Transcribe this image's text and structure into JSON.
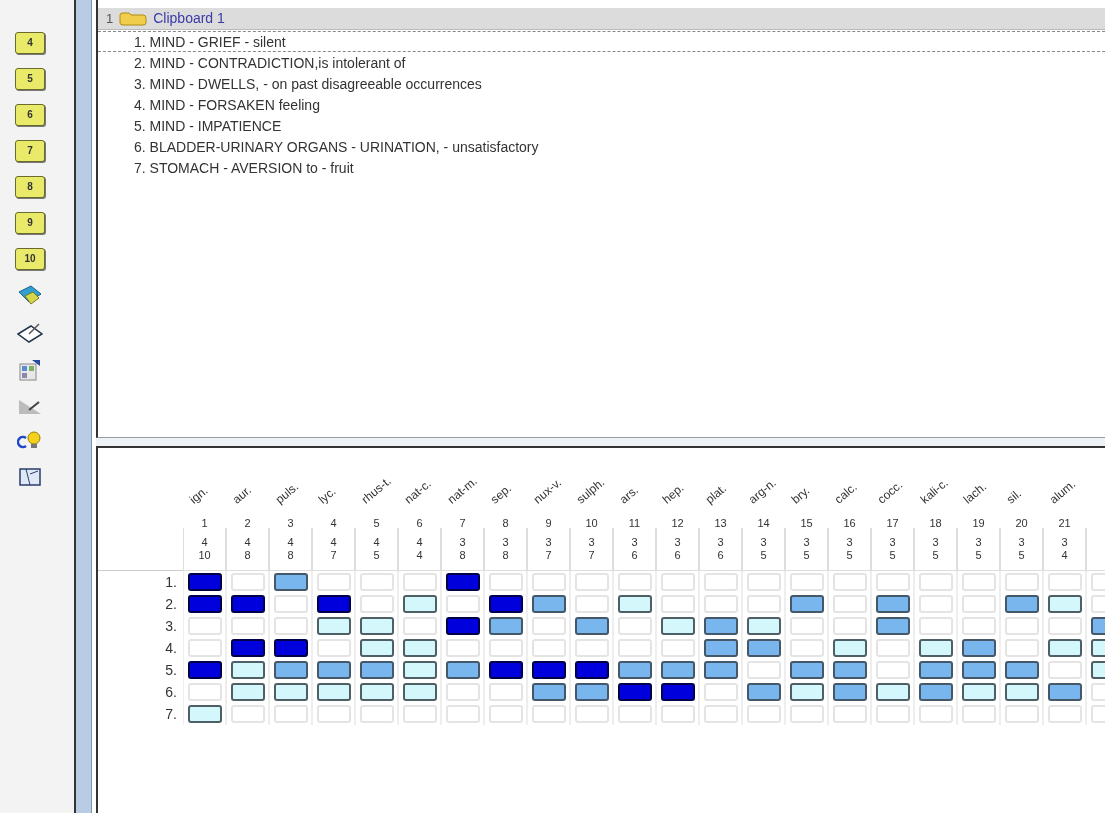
{
  "toolbar": {
    "folders": [
      {
        "label": "4"
      },
      {
        "label": "5"
      },
      {
        "label": "6"
      },
      {
        "label": "7"
      },
      {
        "label": "8"
      },
      {
        "label": "9"
      },
      {
        "label": "10"
      }
    ],
    "tools": [
      {
        "kind": "transfer"
      },
      {
        "kind": "notepad"
      },
      {
        "kind": "calculator"
      },
      {
        "kind": "chart"
      },
      {
        "kind": "idea"
      },
      {
        "kind": "map"
      }
    ]
  },
  "clipboard": {
    "number": "1",
    "title": "Clipboard 1",
    "rubrics": [
      {
        "text": "1. MIND - GRIEF - silent",
        "selected": true
      },
      {
        "text": "2. MIND - CONTRADICTION,is intolerant of",
        "selected": false
      },
      {
        "text": "3. MIND - DWELLS, - on past disagreeable occurrences",
        "selected": false
      },
      {
        "text": "4. MIND - FORSAKEN feeling",
        "selected": false
      },
      {
        "text": "5. MIND - IMPATIENCE",
        "selected": false
      },
      {
        "text": "6. BLADDER-URINARY ORGANS - URINATION, - unsatisfactory",
        "selected": false
      },
      {
        "text": "7. STOMACH - AVERSION to - fruit",
        "selected": false
      }
    ]
  },
  "grid": {
    "remedies": [
      {
        "name": "ign.",
        "rank": "1",
        "score": "4",
        "total": "10"
      },
      {
        "name": "aur.",
        "rank": "2",
        "score": "4",
        "total": "8"
      },
      {
        "name": "puls.",
        "rank": "3",
        "score": "4",
        "total": "8"
      },
      {
        "name": "lyc.",
        "rank": "4",
        "score": "4",
        "total": "7"
      },
      {
        "name": "rhus-t.",
        "rank": "5",
        "score": "4",
        "total": "5"
      },
      {
        "name": "nat-c.",
        "rank": "6",
        "score": "4",
        "total": "4"
      },
      {
        "name": "nat-m.",
        "rank": "7",
        "score": "3",
        "total": "8"
      },
      {
        "name": "sep.",
        "rank": "8",
        "score": "3",
        "total": "8"
      },
      {
        "name": "nux-v.",
        "rank": "9",
        "score": "3",
        "total": "7"
      },
      {
        "name": "sulph.",
        "rank": "10",
        "score": "3",
        "total": "7"
      },
      {
        "name": "ars.",
        "rank": "11",
        "score": "3",
        "total": "6"
      },
      {
        "name": "hep.",
        "rank": "12",
        "score": "3",
        "total": "6"
      },
      {
        "name": "plat.",
        "rank": "13",
        "score": "3",
        "total": "6"
      },
      {
        "name": "arg-n.",
        "rank": "14",
        "score": "3",
        "total": "5"
      },
      {
        "name": "bry.",
        "rank": "15",
        "score": "3",
        "total": "5"
      },
      {
        "name": "calc.",
        "rank": "16",
        "score": "3",
        "total": "5"
      },
      {
        "name": "cocc.",
        "rank": "17",
        "score": "3",
        "total": "5"
      },
      {
        "name": "kali-c.",
        "rank": "18",
        "score": "3",
        "total": "5"
      },
      {
        "name": "lach.",
        "rank": "19",
        "score": "3",
        "total": "5"
      },
      {
        "name": "sil.",
        "rank": "20",
        "score": "3",
        "total": "5"
      },
      {
        "name": "alum.",
        "rank": "21",
        "score": "3",
        "total": "4"
      }
    ],
    "rows": [
      {
        "label": "1.",
        "cells": [
          {
            "kind": "high"
          },
          {
            "kind": "none"
          },
          {
            "kind": "mid"
          },
          {
            "kind": "none"
          },
          {
            "kind": "none"
          },
          {
            "kind": "none"
          },
          {
            "kind": "high"
          },
          {
            "kind": "none"
          },
          {
            "kind": "none"
          },
          {
            "kind": "none"
          },
          {
            "kind": "none"
          },
          {
            "kind": "none"
          },
          {
            "kind": "none"
          },
          {
            "kind": "none"
          },
          {
            "kind": "none"
          },
          {
            "kind": "none"
          },
          {
            "kind": "none"
          },
          {
            "kind": "none"
          },
          {
            "kind": "none"
          },
          {
            "kind": "none"
          },
          {
            "kind": "none"
          },
          {
            "kind": "none"
          }
        ]
      },
      {
        "label": "2.",
        "cells": [
          {
            "kind": "high"
          },
          {
            "kind": "high"
          },
          {
            "kind": "none"
          },
          {
            "kind": "high"
          },
          {
            "kind": "none"
          },
          {
            "kind": "low"
          },
          {
            "kind": "none"
          },
          {
            "kind": "high"
          },
          {
            "kind": "mid"
          },
          {
            "kind": "none"
          },
          {
            "kind": "low"
          },
          {
            "kind": "none"
          },
          {
            "kind": "none"
          },
          {
            "kind": "none"
          },
          {
            "kind": "mid"
          },
          {
            "kind": "none"
          },
          {
            "kind": "mid"
          },
          {
            "kind": "none"
          },
          {
            "kind": "none"
          },
          {
            "kind": "mid"
          },
          {
            "kind": "low"
          },
          {
            "kind": "none"
          }
        ]
      },
      {
        "label": "3.",
        "cells": [
          {
            "kind": "none"
          },
          {
            "kind": "none"
          },
          {
            "kind": "none"
          },
          {
            "kind": "low"
          },
          {
            "kind": "low"
          },
          {
            "kind": "none"
          },
          {
            "kind": "high"
          },
          {
            "kind": "mid"
          },
          {
            "kind": "none"
          },
          {
            "kind": "mid"
          },
          {
            "kind": "none"
          },
          {
            "kind": "low"
          },
          {
            "kind": "mid"
          },
          {
            "kind": "low"
          },
          {
            "kind": "none"
          },
          {
            "kind": "none"
          },
          {
            "kind": "mid"
          },
          {
            "kind": "none"
          },
          {
            "kind": "none"
          },
          {
            "kind": "none"
          },
          {
            "kind": "none"
          },
          {
            "kind": "mid"
          }
        ]
      },
      {
        "label": "4.",
        "cells": [
          {
            "kind": "none"
          },
          {
            "kind": "high"
          },
          {
            "kind": "high"
          },
          {
            "kind": "none"
          },
          {
            "kind": "low"
          },
          {
            "kind": "low"
          },
          {
            "kind": "none"
          },
          {
            "kind": "none"
          },
          {
            "kind": "none"
          },
          {
            "kind": "none"
          },
          {
            "kind": "none"
          },
          {
            "kind": "none"
          },
          {
            "kind": "mid"
          },
          {
            "kind": "mid"
          },
          {
            "kind": "none"
          },
          {
            "kind": "low"
          },
          {
            "kind": "none"
          },
          {
            "kind": "low"
          },
          {
            "kind": "mid"
          },
          {
            "kind": "none"
          },
          {
            "kind": "low"
          },
          {
            "kind": "low"
          }
        ]
      },
      {
        "label": "5.",
        "cells": [
          {
            "kind": "high"
          },
          {
            "kind": "low"
          },
          {
            "kind": "mid"
          },
          {
            "kind": "mid"
          },
          {
            "kind": "mid"
          },
          {
            "kind": "low"
          },
          {
            "kind": "mid"
          },
          {
            "kind": "high"
          },
          {
            "kind": "high"
          },
          {
            "kind": "high"
          },
          {
            "kind": "mid"
          },
          {
            "kind": "mid"
          },
          {
            "kind": "mid"
          },
          {
            "kind": "none"
          },
          {
            "kind": "mid"
          },
          {
            "kind": "mid"
          },
          {
            "kind": "none"
          },
          {
            "kind": "mid"
          },
          {
            "kind": "mid"
          },
          {
            "kind": "mid"
          },
          {
            "kind": "none"
          },
          {
            "kind": "low"
          }
        ]
      },
      {
        "label": "6.",
        "cells": [
          {
            "kind": "none"
          },
          {
            "kind": "low"
          },
          {
            "kind": "low"
          },
          {
            "kind": "low"
          },
          {
            "kind": "low"
          },
          {
            "kind": "low"
          },
          {
            "kind": "none"
          },
          {
            "kind": "none"
          },
          {
            "kind": "mid"
          },
          {
            "kind": "mid"
          },
          {
            "kind": "high"
          },
          {
            "kind": "high"
          },
          {
            "kind": "none"
          },
          {
            "kind": "mid"
          },
          {
            "kind": "low"
          },
          {
            "kind": "mid"
          },
          {
            "kind": "low"
          },
          {
            "kind": "mid"
          },
          {
            "kind": "low"
          },
          {
            "kind": "low"
          },
          {
            "kind": "mid"
          },
          {
            "kind": "none"
          }
        ]
      },
      {
        "label": "7.",
        "cells": [
          {
            "kind": "low"
          },
          {
            "kind": "none"
          },
          {
            "kind": "none"
          },
          {
            "kind": "none"
          },
          {
            "kind": "none"
          },
          {
            "kind": "none"
          },
          {
            "kind": "none"
          },
          {
            "kind": "none"
          },
          {
            "kind": "none"
          },
          {
            "kind": "none"
          },
          {
            "kind": "none"
          },
          {
            "kind": "none"
          },
          {
            "kind": "none"
          },
          {
            "kind": "none"
          },
          {
            "kind": "none"
          },
          {
            "kind": "none"
          },
          {
            "kind": "none"
          },
          {
            "kind": "none"
          },
          {
            "kind": "none"
          },
          {
            "kind": "none"
          },
          {
            "kind": "none"
          },
          {
            "kind": "none"
          }
        ]
      }
    ]
  }
}
